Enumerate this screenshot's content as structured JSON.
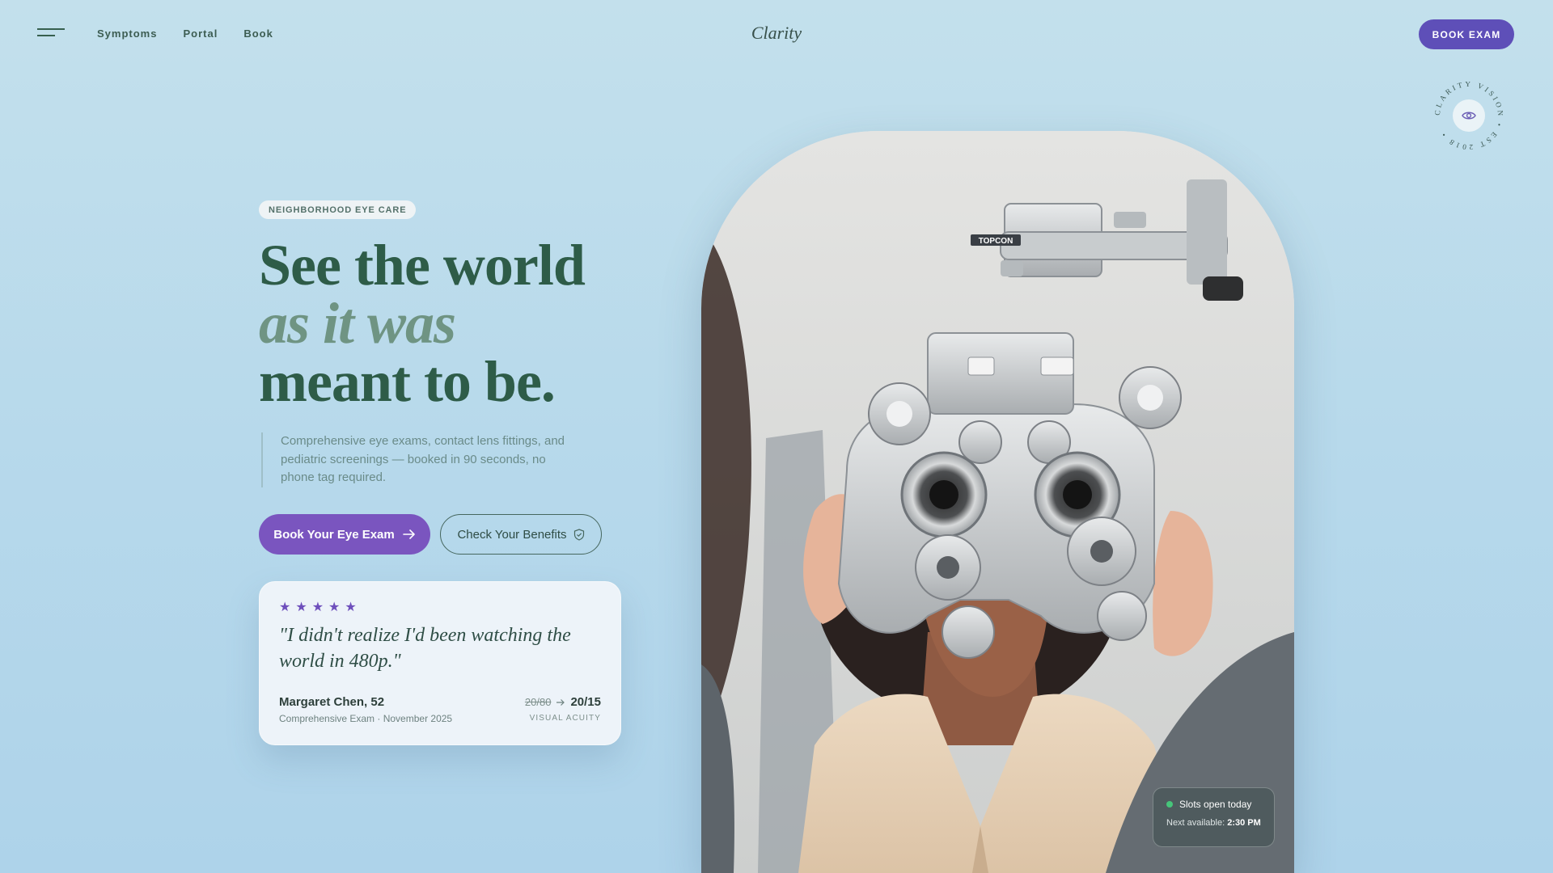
{
  "header": {
    "nav": [
      "Symptoms",
      "Portal",
      "Book"
    ],
    "logo": "Clarity",
    "book_exam_label": "BOOK EXAM"
  },
  "seal": {
    "text": "CLARITY VISION • EST 2018 •",
    "icon": "eye-icon"
  },
  "hero": {
    "eyebrow": "NEIGHBORHOOD EYE CARE",
    "headline_line1": "See the world",
    "headline_line2": "as it was",
    "headline_line3": "meant to be.",
    "lede": "Comprehensive eye exams, contact lens fittings, and pediatric screenings — booked in 90 seconds, no phone tag required.",
    "primary_cta": "Book Your Eye Exam",
    "secondary_cta": "Check Your Benefits"
  },
  "review": {
    "stars": 5,
    "quote": "\"I didn't realize I'd been watching the world in 480p.\"",
    "name": "Margaret Chen, 52",
    "exam": "Comprehensive Exam · November 2025",
    "acuity_before": "20/80",
    "acuity_after": "20/15",
    "acuity_label": "VISUAL ACUITY"
  },
  "availability": {
    "status": "Slots open today",
    "next_label": "Next available:",
    "next_time": "2:30 PM"
  },
  "photo": {
    "brand_on_device": "TOPCON"
  },
  "colors": {
    "accent": "#5e4fb8",
    "cta": "#7a55bf",
    "green_text": "#2e5c48",
    "available": "#46c57a"
  }
}
